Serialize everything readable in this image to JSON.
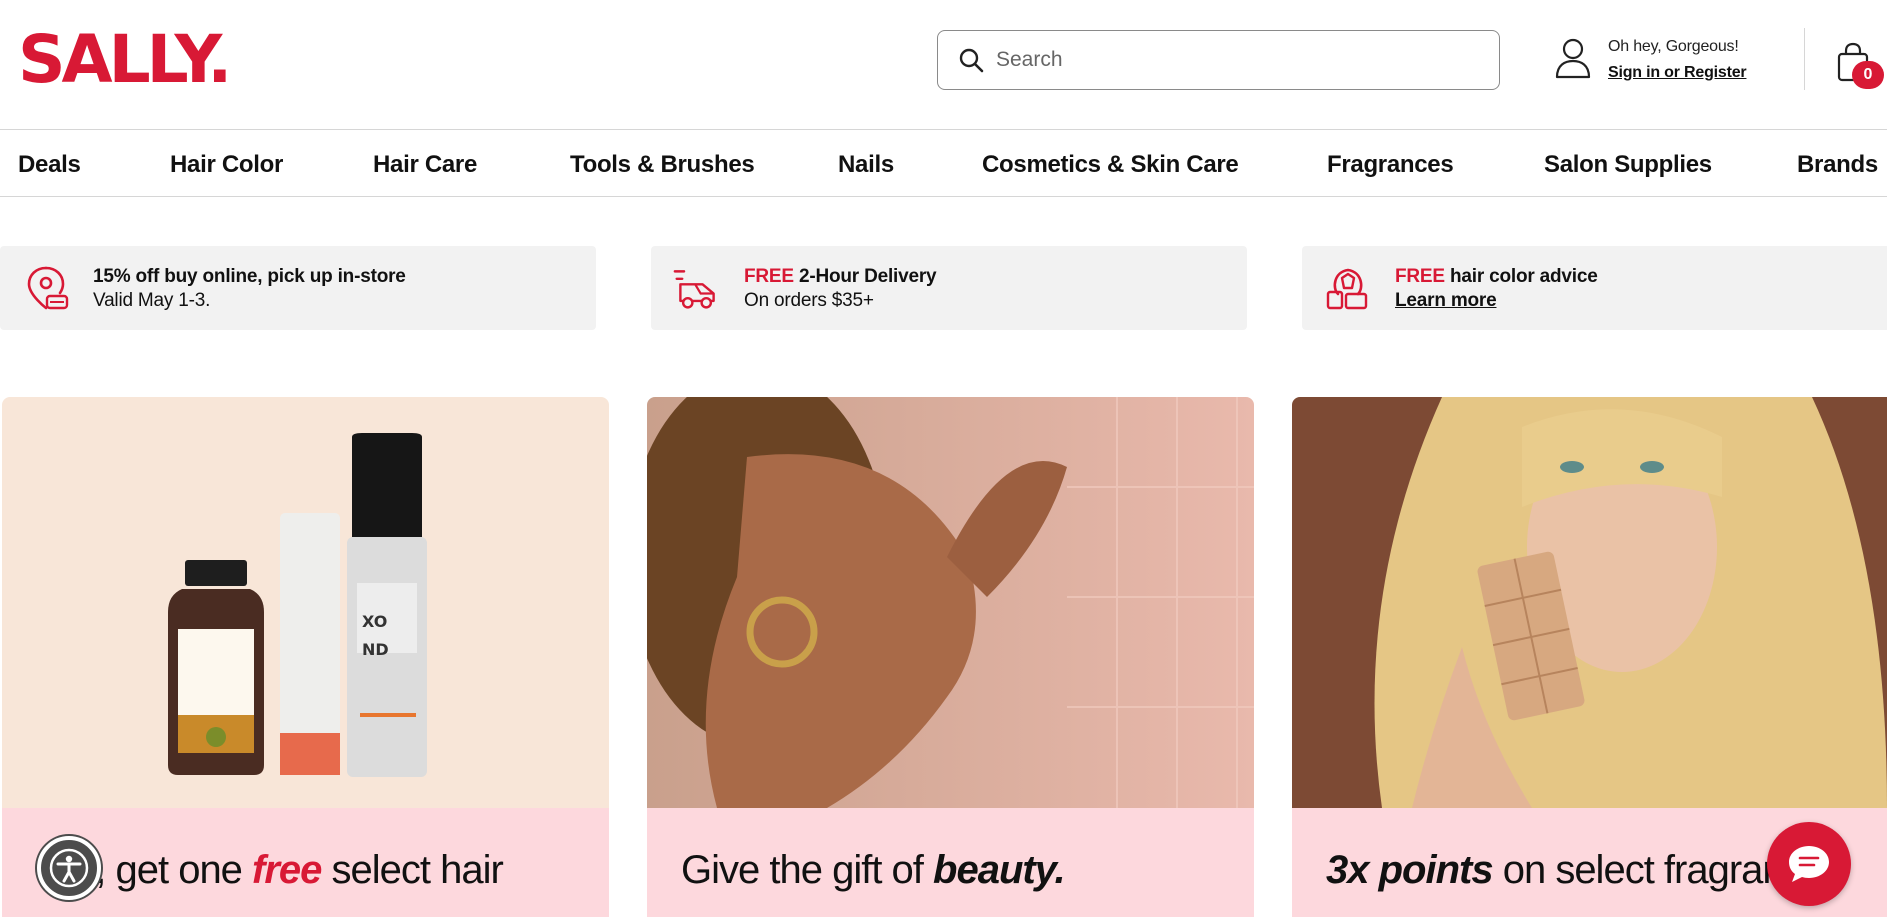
{
  "brand": {
    "logo_text": "SALLY.",
    "accent_color": "#d81935"
  },
  "search": {
    "placeholder": "Search",
    "value": ""
  },
  "account": {
    "greeting": "Oh hey, Gorgeous!",
    "signin_label": "Sign in or Register"
  },
  "cart": {
    "count": "0"
  },
  "nav": {
    "items": [
      {
        "label": "Deals"
      },
      {
        "label": "Hair Color"
      },
      {
        "label": "Hair Care"
      },
      {
        "label": "Tools & Brushes"
      },
      {
        "label": "Nails"
      },
      {
        "label": "Cosmetics & Skin Care"
      },
      {
        "label": "Fragrances"
      },
      {
        "label": "Salon Supplies"
      },
      {
        "label": "Brands"
      }
    ]
  },
  "promos": [
    {
      "icon": "store-pickup-icon",
      "line1": "15% off buy online, pick up in-store",
      "line2": "Valid May 1-3."
    },
    {
      "icon": "delivery-truck-icon",
      "free": "FREE",
      "line1": "2-Hour Delivery",
      "line2": "On orders $35+"
    },
    {
      "icon": "hair-color-advice-icon",
      "free": "FREE",
      "line1": "hair color advice",
      "link": "Learn more"
    }
  ],
  "cards": [
    {
      "caption_pre": "two, get one ",
      "caption_em": "free",
      "caption_post": " select hair"
    },
    {
      "caption_pre": "Give the gift of ",
      "caption_em": "beauty."
    },
    {
      "caption_em": "3x points",
      "caption_post": " on select fragrance"
    }
  ],
  "floating": {
    "accessibility_icon": "accessibility-icon",
    "chat_icon": "chat-icon"
  }
}
